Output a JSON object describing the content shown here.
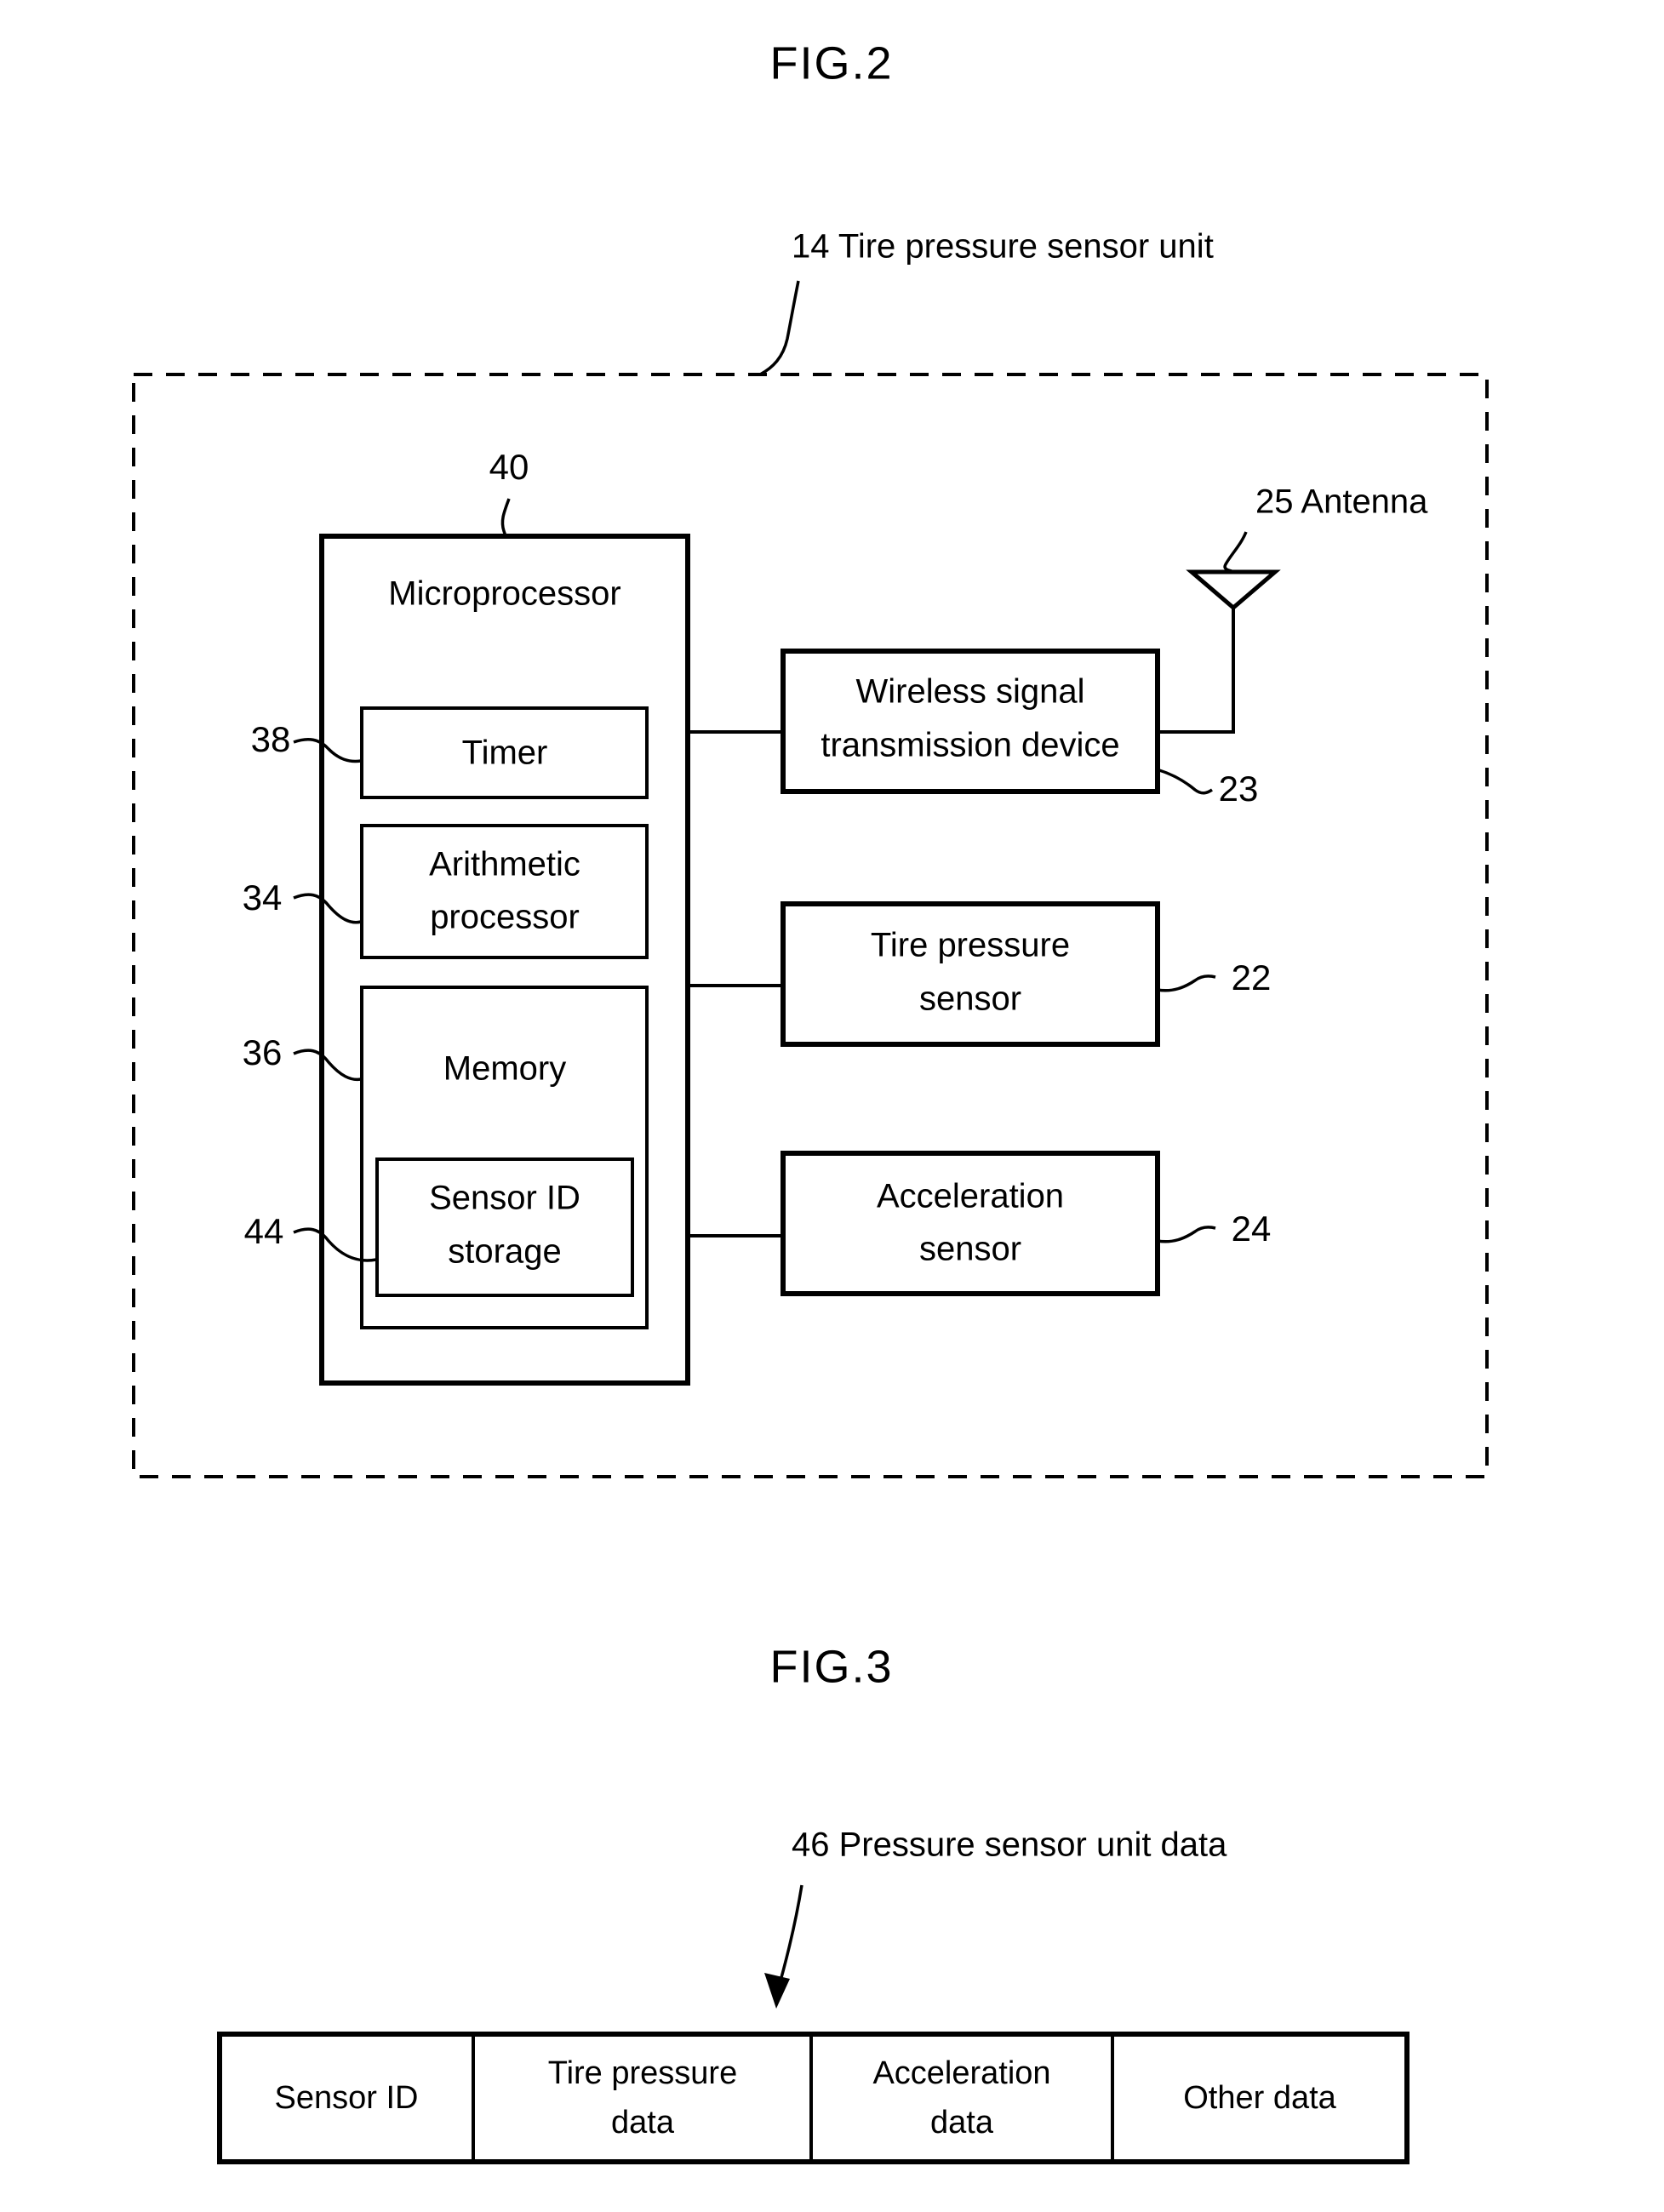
{
  "figures": [
    {
      "id": "fig2",
      "title": "FIG.2",
      "outer_label": {
        "number": "14",
        "text": "14 Tire pressure sensor unit"
      },
      "microprocessor": {
        "ref": "40",
        "label": "Microprocessor",
        "blocks": [
          {
            "ref": "38",
            "label": "Timer"
          },
          {
            "ref": "34",
            "label_line1": "Arithmetic",
            "label_line2": "processor"
          },
          {
            "ref": "36",
            "label": "Memory"
          },
          {
            "ref": "44",
            "label_line1": "Sensor ID",
            "label_line2": "storage"
          }
        ]
      },
      "peripherals": [
        {
          "ref": "23",
          "label_line1": "Wireless signal",
          "label_line2": "transmission device"
        },
        {
          "ref": "22",
          "label_line1": "Tire pressure",
          "label_line2": "sensor"
        },
        {
          "ref": "24",
          "label_line1": "Acceleration",
          "label_line2": "sensor"
        }
      ],
      "antenna": {
        "ref": "25",
        "text": "25 Antenna",
        "icon": "antenna-icon"
      }
    },
    {
      "id": "fig3",
      "title": "FIG.3",
      "data_label": {
        "number": "46",
        "text": "46 Pressure sensor unit data"
      },
      "table": {
        "cells": [
          {
            "line1": "Sensor ID",
            "line2": ""
          },
          {
            "line1": "Tire pressure",
            "line2": "data"
          },
          {
            "line1": "Acceleration",
            "line2": "data"
          },
          {
            "line1": "Other data",
            "line2": ""
          }
        ]
      }
    }
  ],
  "colors": {
    "ink": "#000000",
    "paper": "#ffffff"
  }
}
